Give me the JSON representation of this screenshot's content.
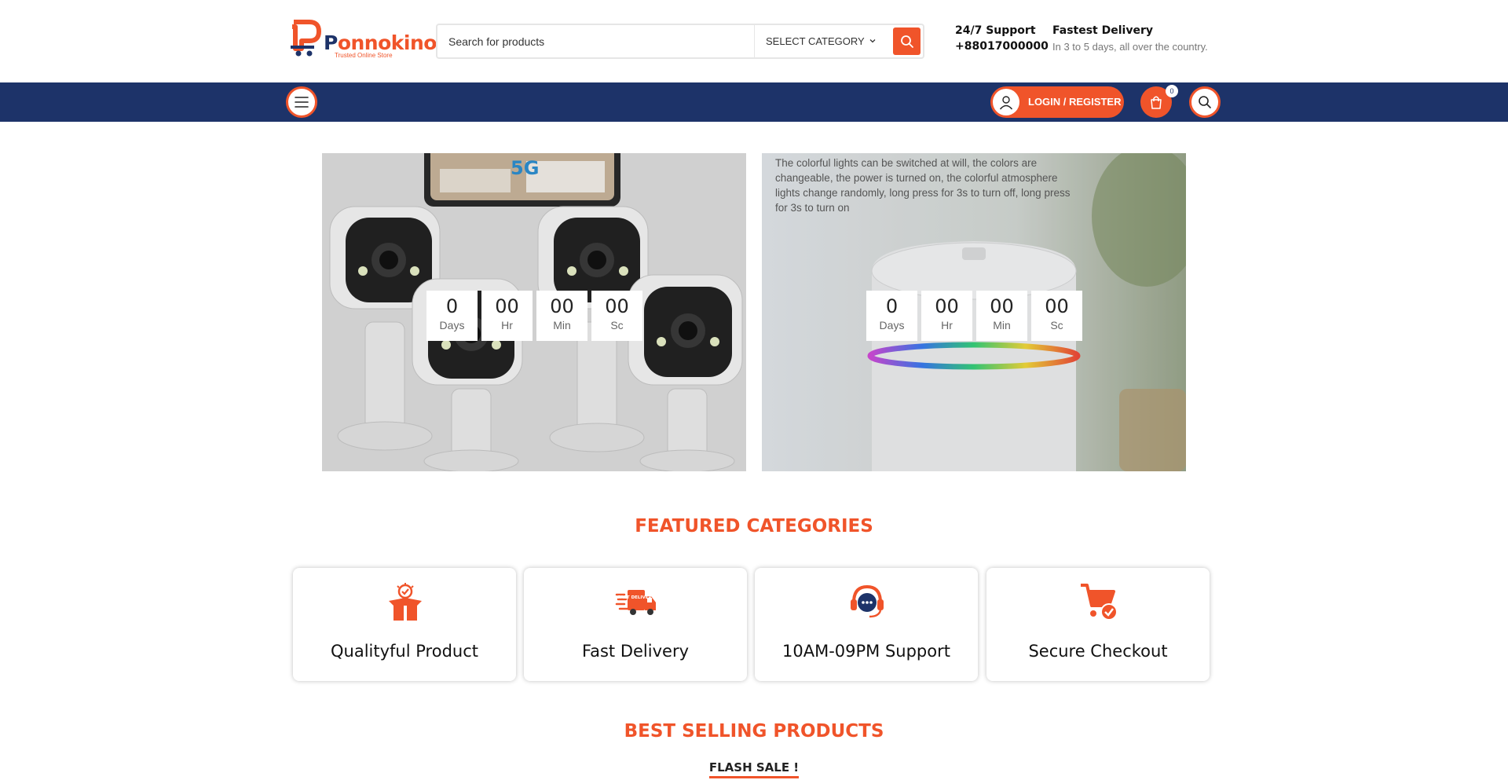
{
  "header": {
    "brand_part1": "P",
    "brand_part2": "onnokino",
    "tagline": "Trusted Online Store",
    "search": {
      "placeholder": "Search for products"
    },
    "category_select": "SELECT CATEGORY",
    "support": {
      "line1": "24/7  Support",
      "line2": "+88017000000"
    },
    "delivery": {
      "title": "Fastest Delivery",
      "subtitle": "In 3 to 5 days, all over the country."
    }
  },
  "navbar": {
    "login_label": "LOGIN / REGISTER",
    "cart_count": "0"
  },
  "banners": [
    {
      "image_text": "5G",
      "countdown": [
        {
          "value": "0",
          "unit": "Days"
        },
        {
          "value": "00",
          "unit": "Hr"
        },
        {
          "value": "00",
          "unit": "Min"
        },
        {
          "value": "00",
          "unit": "Sc"
        }
      ]
    },
    {
      "caption": "The colorful lights can be switched at will, the colors are changeable, the power is turned on, the colorful atmosphere lights change randomly, long press for 3s to turn off, long press for 3s to turn on",
      "countdown": [
        {
          "value": "0",
          "unit": "Days"
        },
        {
          "value": "00",
          "unit": "Hr"
        },
        {
          "value": "00",
          "unit": "Min"
        },
        {
          "value": "00",
          "unit": "Sc"
        }
      ]
    }
  ],
  "featured": {
    "title": "FEATURED CATEGORIES",
    "cards": [
      {
        "label": "Qualityful Product",
        "icon": "gift-box-icon"
      },
      {
        "label": "Fast Delivery",
        "icon": "delivery-truck-icon",
        "icon_text": "FAST DELIVERY"
      },
      {
        "label": "10AM-09PM Support",
        "icon": "headset-support-icon"
      },
      {
        "label": "Secure Checkout",
        "icon": "cart-check-icon"
      }
    ]
  },
  "best_selling": {
    "title": "BEST SELLING PRODUCTS",
    "flash_label": "FLASH SALE !"
  },
  "colors": {
    "accent": "#f0542a",
    "navy": "#1d3369"
  }
}
